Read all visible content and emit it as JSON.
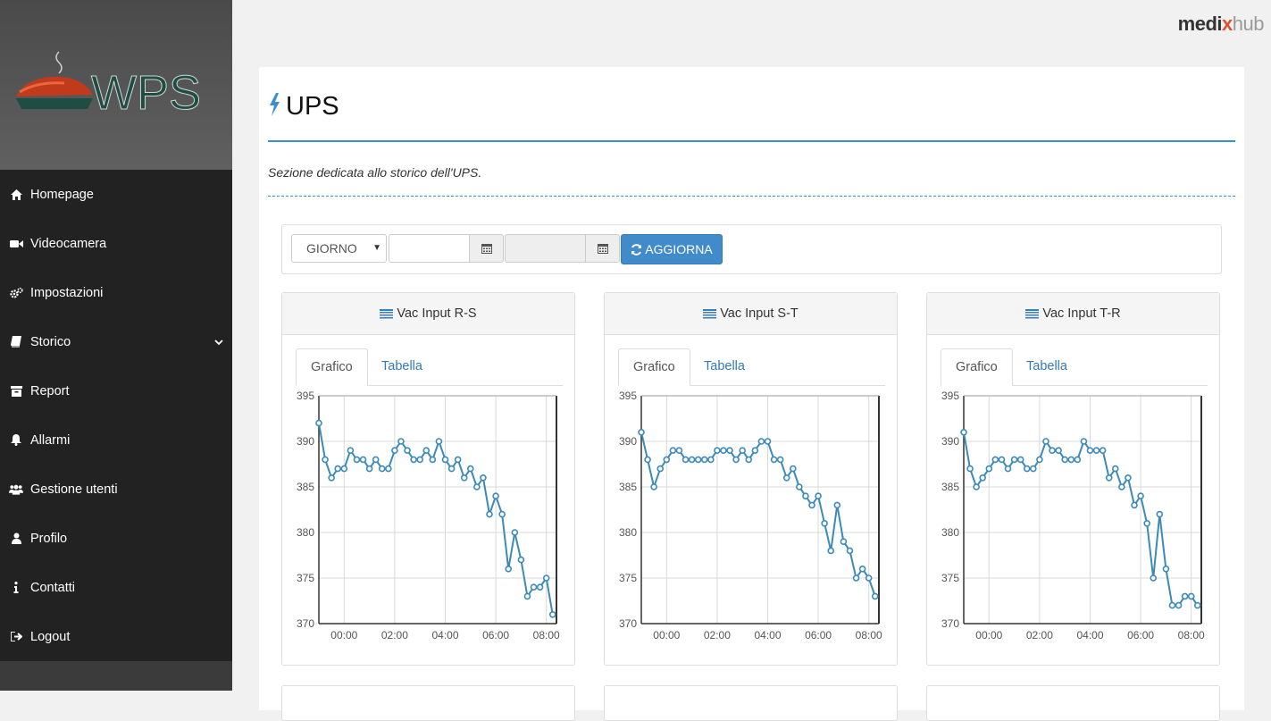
{
  "brand": {
    "part1": "medi",
    "part2": "x",
    "part3": "hub"
  },
  "logo": {
    "text": "WPS"
  },
  "sidebar": {
    "items": [
      {
        "label": "Homepage",
        "icon": "home-icon"
      },
      {
        "label": "Videocamera",
        "icon": "video-camera-icon"
      },
      {
        "label": "Impostazioni",
        "icon": "gears-icon"
      },
      {
        "label": "Storico",
        "icon": "book-icon",
        "expandable": true
      },
      {
        "label": "Report",
        "icon": "archive-icon"
      },
      {
        "label": "Allarmi",
        "icon": "bell-icon"
      },
      {
        "label": "Gestione utenti",
        "icon": "users-icon"
      },
      {
        "label": "Profilo",
        "icon": "user-icon"
      },
      {
        "label": "Contatti",
        "icon": "info-icon"
      },
      {
        "label": "Logout",
        "icon": "sign-out-icon"
      }
    ]
  },
  "page": {
    "title": "UPS",
    "subtitle": "Sezione dedicata allo storico dell'UPS."
  },
  "filter": {
    "period": "GIORNO",
    "date_from": "",
    "date_to": "",
    "refresh_label": "AGGIORNA"
  },
  "tabs": {
    "chart": "Grafico",
    "table": "Tabella"
  },
  "colors": {
    "accent": "#3a8fd1",
    "button": "#428bca",
    "line": "#3b8ab8",
    "sidebar": "#222222"
  },
  "chart_data": [
    {
      "type": "line",
      "title": "Vac Input R-S",
      "ylim": [
        370,
        395
      ],
      "yticks": [
        370,
        375,
        380,
        385,
        390,
        395
      ],
      "xticks": [
        "00:00",
        "02:00",
        "04:00",
        "06:00",
        "08:00"
      ],
      "x": [
        -1.0,
        -0.75,
        -0.5,
        -0.25,
        0.0,
        0.25,
        0.5,
        0.75,
        1.0,
        1.25,
        1.5,
        1.75,
        2.0,
        2.25,
        2.5,
        2.75,
        3.0,
        3.25,
        3.5,
        3.75,
        4.0,
        4.25,
        4.5,
        4.75,
        5.0,
        5.25,
        5.5,
        5.75,
        6.0,
        6.25,
        6.5,
        6.75,
        7.0,
        7.25,
        7.5,
        7.75,
        8.0,
        8.25
      ],
      "values": [
        392,
        388,
        386,
        387,
        387,
        389,
        388,
        388,
        387,
        388,
        387,
        387,
        389,
        390,
        389,
        388,
        388,
        389,
        388,
        390,
        388,
        387,
        388,
        386,
        387,
        385,
        386,
        382,
        384,
        382,
        376,
        380,
        377,
        373,
        374,
        374,
        375,
        371
      ]
    },
    {
      "type": "line",
      "title": "Vac Input S-T",
      "ylim": [
        370,
        395
      ],
      "yticks": [
        370,
        375,
        380,
        385,
        390,
        395
      ],
      "xticks": [
        "00:00",
        "02:00",
        "04:00",
        "06:00",
        "08:00"
      ],
      "x": [
        -1.0,
        -0.75,
        -0.5,
        -0.25,
        0.0,
        0.25,
        0.5,
        0.75,
        1.0,
        1.25,
        1.5,
        1.75,
        2.0,
        2.25,
        2.5,
        2.75,
        3.0,
        3.25,
        3.5,
        3.75,
        4.0,
        4.25,
        4.5,
        4.75,
        5.0,
        5.25,
        5.5,
        5.75,
        6.0,
        6.25,
        6.5,
        6.75,
        7.0,
        7.25,
        7.5,
        7.75,
        8.0,
        8.25
      ],
      "values": [
        391,
        388,
        385,
        387,
        388,
        389,
        389,
        388,
        388,
        388,
        388,
        388,
        389,
        389,
        389,
        388,
        389,
        388,
        389,
        390,
        390,
        388,
        388,
        386,
        387,
        385,
        384,
        383,
        384,
        381,
        378,
        383,
        379,
        378,
        375,
        376,
        375,
        373
      ]
    },
    {
      "type": "line",
      "title": "Vac Input T-R",
      "ylim": [
        370,
        395
      ],
      "yticks": [
        370,
        375,
        380,
        385,
        390,
        395
      ],
      "xticks": [
        "00:00",
        "02:00",
        "04:00",
        "06:00",
        "08:00"
      ],
      "x": [
        -1.0,
        -0.75,
        -0.5,
        -0.25,
        0.0,
        0.25,
        0.5,
        0.75,
        1.0,
        1.25,
        1.5,
        1.75,
        2.0,
        2.25,
        2.5,
        2.75,
        3.0,
        3.25,
        3.5,
        3.75,
        4.0,
        4.25,
        4.5,
        4.75,
        5.0,
        5.25,
        5.5,
        5.75,
        6.0,
        6.25,
        6.5,
        6.75,
        7.0,
        7.25,
        7.5,
        7.75,
        8.0,
        8.25
      ],
      "values": [
        391,
        387,
        385,
        386,
        387,
        388,
        388,
        387,
        388,
        388,
        387,
        387,
        388,
        390,
        389,
        389,
        388,
        388,
        388,
        390,
        389,
        389,
        389,
        386,
        387,
        385,
        386,
        383,
        384,
        381,
        375,
        382,
        376,
        372,
        372,
        373,
        373,
        372
      ]
    }
  ]
}
